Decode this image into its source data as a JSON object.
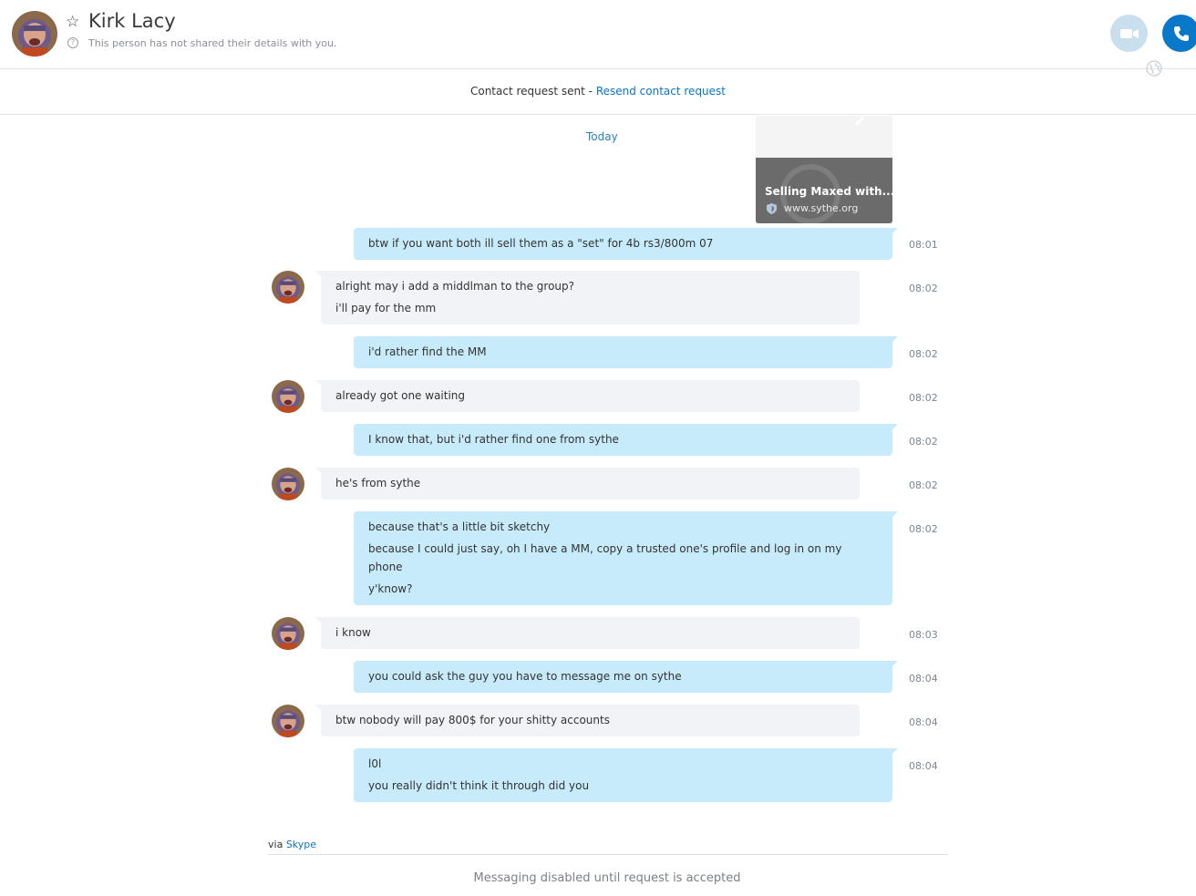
{
  "header": {
    "contact_name": "Kirk Lacy",
    "subtitle": "This person has not shared their details with you.",
    "info_glyph": "?",
    "star_glyph": "☆",
    "video_button_icon": "video-camera-icon",
    "call_button_icon": "phone-icon",
    "globe_icon": "globe-icon"
  },
  "request_bar": {
    "status_text": "Contact request sent - ",
    "resend_link": "Resend contact request"
  },
  "conversation": {
    "date_divider": "Today",
    "link_preview": {
      "title": "Selling Maxed with...",
      "url": "www.sythe.org"
    },
    "messages": [
      {
        "sender": "me",
        "lines": [
          "btw if you want both ill sell them as a \"set\" for 4b rs3/800m 07"
        ],
        "time": "08:01"
      },
      {
        "sender": "Kirk Lacy",
        "lines": [
          "alright may i add a middlman to the group?",
          "i'll pay for the mm"
        ],
        "time": "08:02"
      },
      {
        "sender": "me",
        "lines": [
          "i'd rather find the MM"
        ],
        "time": "08:02"
      },
      {
        "sender": "Kirk Lacy",
        "lines": [
          "already got one waiting"
        ],
        "time": "08:02"
      },
      {
        "sender": "me",
        "lines": [
          "I know that, but i'd rather find one from sythe"
        ],
        "time": "08:02"
      },
      {
        "sender": "Kirk Lacy",
        "lines": [
          "he's from sythe"
        ],
        "time": "08:02"
      },
      {
        "sender": "me",
        "lines": [
          "because that's a little bit sketchy",
          "because I could just say, oh I have a MM, copy a trusted one's profile and log in on my",
          "phone",
          "y'know?"
        ],
        "time": "08:02"
      },
      {
        "sender": "Kirk Lacy",
        "lines": [
          "i know"
        ],
        "time": "08:03"
      },
      {
        "sender": "me",
        "lines": [
          "you could ask the guy you have to message me on sythe"
        ],
        "time": "08:04"
      },
      {
        "sender": "Kirk Lacy",
        "lines": [
          "btw nobody will pay 800$ for your shitty accounts"
        ],
        "time": "08:04"
      },
      {
        "sender": "me",
        "lines": [
          "l0l",
          "you really didn't think it through did you"
        ],
        "time": "08:04"
      }
    ]
  },
  "footer": {
    "via_prefix": "via ",
    "via_link": "Skype",
    "disabled_notice": "Messaging disabled until request is accepted"
  },
  "colors": {
    "outgoing_bubble": "#c7ebfa",
    "incoming_bubble": "#f1f3f6",
    "accent": "#0a78c8"
  }
}
